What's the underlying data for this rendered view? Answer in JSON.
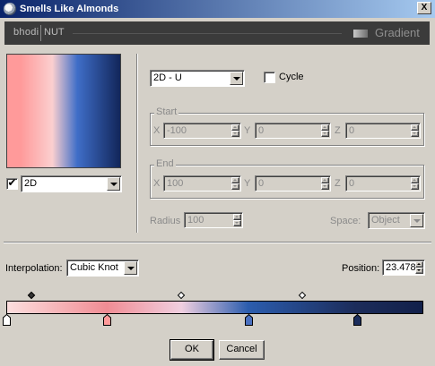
{
  "window": {
    "title": "Smells Like Almonds",
    "close_glyph": "X"
  },
  "banner": {
    "brand_left": "bhodi",
    "brand_right": "NUT",
    "label": "Gradient"
  },
  "preview": {
    "colors": [
      "#ff9a9a",
      "#fbcfcf",
      "#3f6ec8",
      "#12265a"
    ]
  },
  "dimension": {
    "checked": true,
    "value": "2D"
  },
  "mode": {
    "value": "2D - U"
  },
  "cycle": {
    "label": "Cycle",
    "checked": false
  },
  "start": {
    "label": "Start",
    "x_label": "X",
    "x": "-100",
    "y_label": "Y",
    "y": "0",
    "z_label": "Z",
    "z": "0"
  },
  "end": {
    "label": "End",
    "x_label": "X",
    "x": "100",
    "y_label": "Y",
    "y": "0",
    "z_label": "Z",
    "z": "0"
  },
  "radius": {
    "label": "Radius",
    "value": "100"
  },
  "space": {
    "label": "Space:",
    "value": "Object"
  },
  "interpolation": {
    "label": "Interpolation:",
    "value": "Cubic Knot"
  },
  "position": {
    "label": "Position:",
    "value": "23.478"
  },
  "gradient": {
    "knots": [
      {
        "pos": 0.0,
        "color": "#ffffff"
      },
      {
        "pos": 0.24,
        "color": "#ff9a9a"
      },
      {
        "pos": 0.58,
        "color": "#4a70c0"
      },
      {
        "pos": 0.84,
        "color": "#1b2d5c"
      }
    ],
    "handles": [
      {
        "pos": 0.06,
        "filled": true
      },
      {
        "pos": 0.42,
        "filled": false
      },
      {
        "pos": 0.71,
        "filled": false
      }
    ],
    "stops": [
      {
        "pos": 0.0,
        "color": "#fcdede"
      },
      {
        "pos": 0.24,
        "color": "#f08c94"
      },
      {
        "pos": 0.42,
        "color": "#f0cfe0"
      },
      {
        "pos": 0.58,
        "color": "#2c5dae"
      },
      {
        "pos": 0.84,
        "color": "#1c2c5a"
      },
      {
        "pos": 1.0,
        "color": "#12204a"
      }
    ]
  },
  "buttons": {
    "ok": "OK",
    "cancel": "Cancel"
  }
}
